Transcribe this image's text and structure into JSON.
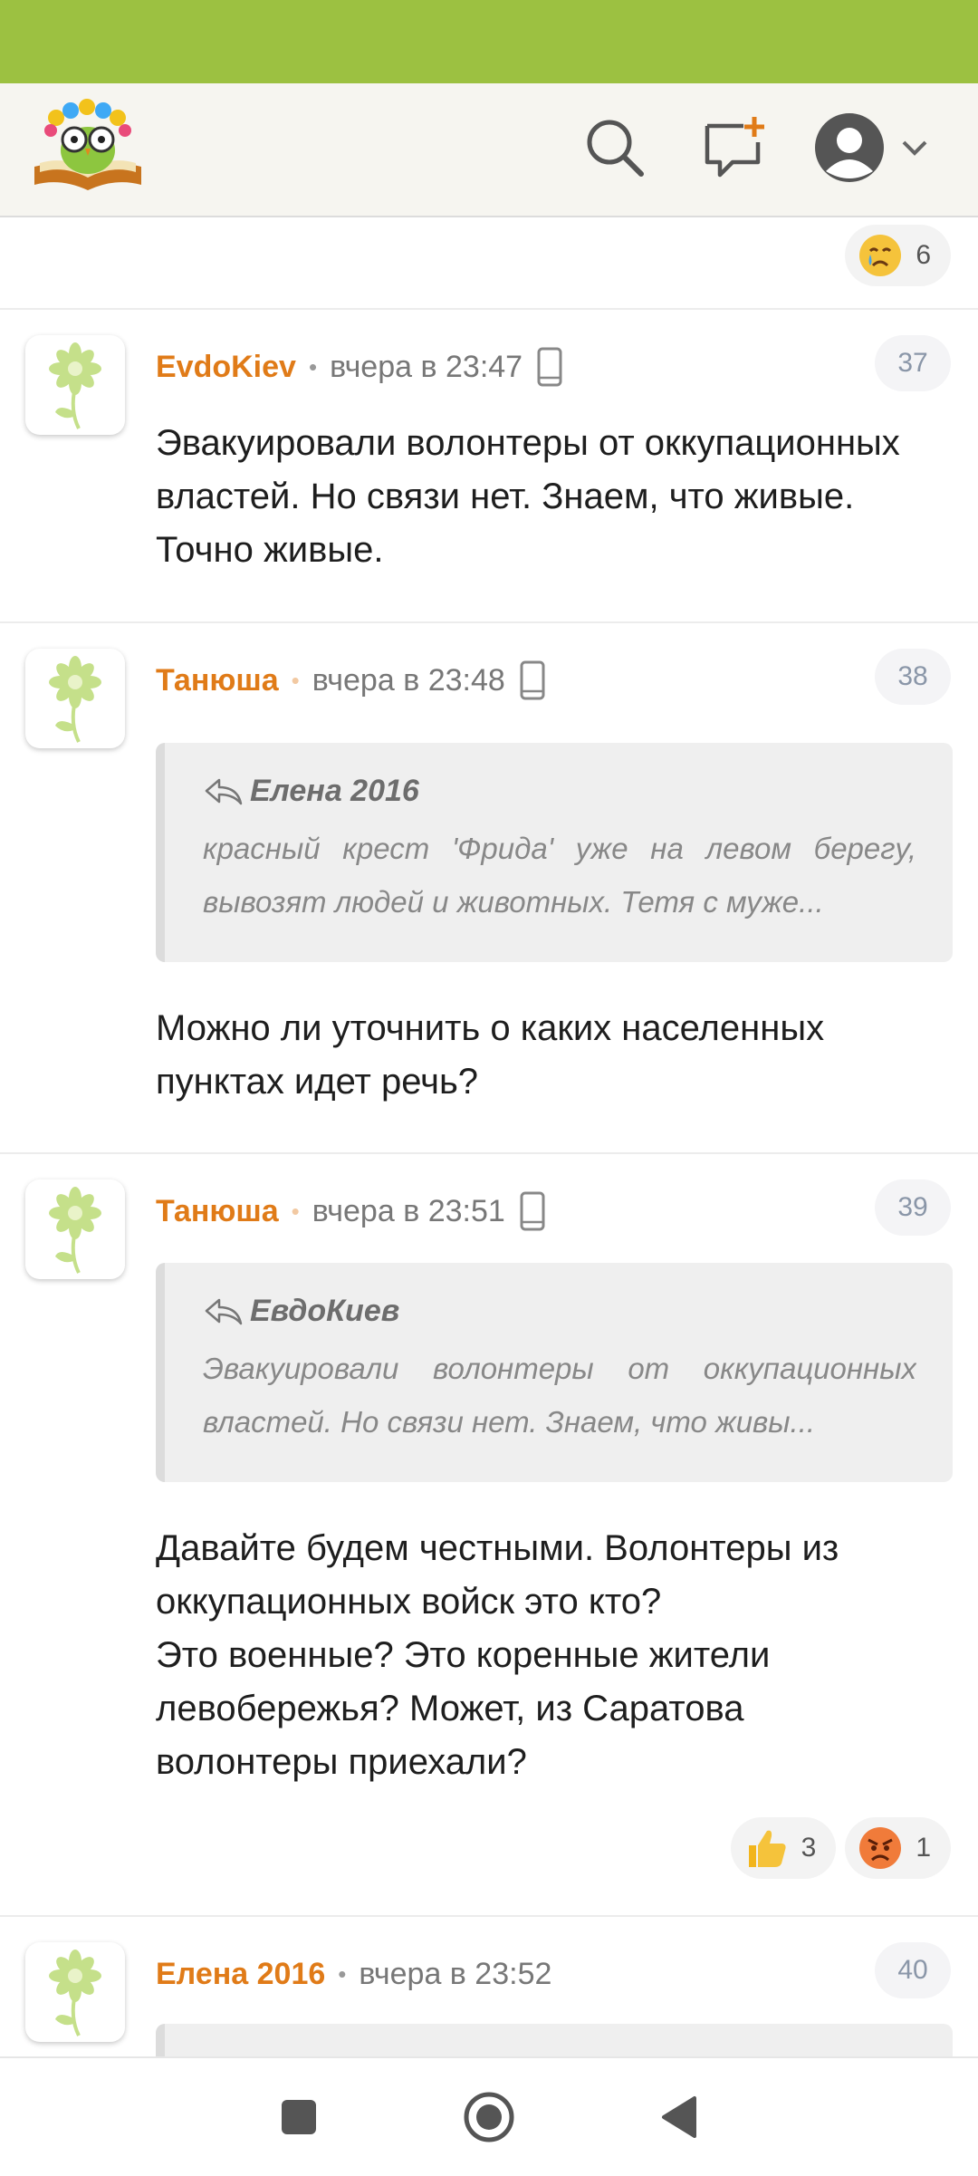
{
  "colors": {
    "accent": "#9cc141",
    "author": "#e07b18",
    "header_bg": "#f6f5f0"
  },
  "header": {
    "logo_icon": "owl-book-logo",
    "search_icon": "search-icon",
    "new_comment_icon": "new-comment-icon",
    "profile_icon": "user-avatar-icon",
    "menu_icon": "chevron-down-icon"
  },
  "top_reactions": [
    {
      "icon": "crying-face-icon",
      "count": "6"
    }
  ],
  "comments": [
    {
      "author": "EvdoKiev",
      "time": "вчера в 23:47",
      "number": "37",
      "text": "Эвакуировали волонтеры от оккупационных властей. Но связи нет. Знаем, что живые. Точно живые."
    },
    {
      "author": "Танюша",
      "time": "вчера в 23:48",
      "number": "38",
      "quote": {
        "author": "Елена 2016",
        "text": "красный крест 'Фрида' уже на левом берегу, вывозят людей и животных. Тетя с муже..."
      },
      "text": "Можно ли уточнить о каких населенных пунктах идет речь?"
    },
    {
      "author": "Танюша",
      "time": "вчера в 23:51",
      "number": "39",
      "quote": {
        "author": "ЕвдоКиев",
        "text": "Эвакуировали волонтеры от оккупационных властей. Но связи нет. Знаем, что живы..."
      },
      "text": "Давайте будем честными. Волонтеры из оккупационных войск это кто?\nЭто военные? Это коренные жители левобережья? Может, из Саратова волонтеры приехали?",
      "reactions": [
        {
          "icon": "thumbs-up-icon",
          "count": "3"
        },
        {
          "icon": "angry-face-icon",
          "count": "1"
        }
      ]
    },
    {
      "author": "Елена 2016",
      "time": "вчера в 23:52",
      "number": "40"
    }
  ],
  "navbar": {
    "recents_icon": "square-icon",
    "home_icon": "circle-icon",
    "back_icon": "back-triangle-icon"
  }
}
